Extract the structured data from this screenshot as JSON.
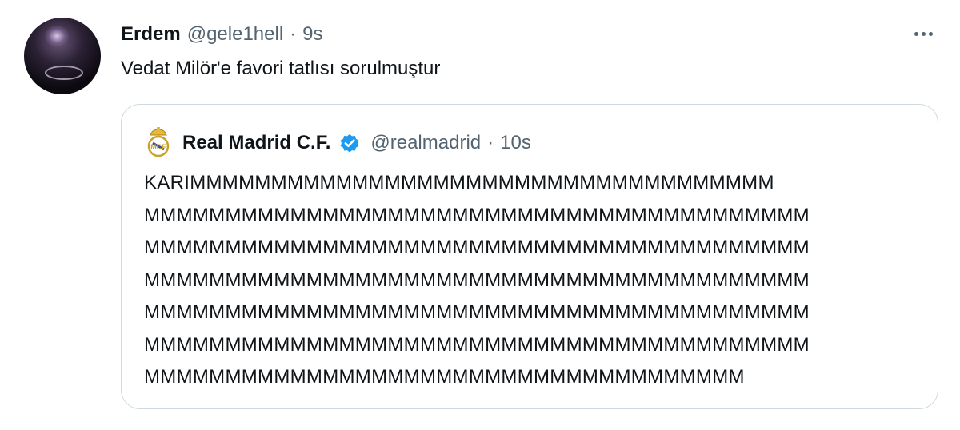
{
  "tweet": {
    "author_name": "Erdem",
    "author_handle": "@gele1hell",
    "separator": "·",
    "timestamp": "9s",
    "text": "Vedat Milör'e favori tatlısı sorulmuştur"
  },
  "quoted_tweet": {
    "author_name": "Real Madrid C.F.",
    "author_handle": "@realmadrid",
    "separator": "·",
    "timestamp": "10s",
    "verified": true,
    "lines": [
      "KARIMMMMMMMMMMMMMMMMMMMMMMMMMMMMMMMMMMMM",
      "MMMMMMMMMMMMMMMMMMMMMMMMMMMMMMMMMMMMMMMMM",
      "MMMMMMMMMMMMMMMMMMMMMMMMMMMMMMMMMMMMMMMMM",
      "MMMMMMMMMMMMMMMMMMMMMMMMMMMMMMMMMMMMMMMMM",
      "MMMMMMMMMMMMMMMMMMMMMMMMMMMMMMMMMMMMMMMMM",
      "MMMMMMMMMMMMMMMMMMMMMMMMMMMMMMMMMMMMMMMMM",
      "MMMMMMMMMMMMMMMMMMMMMMMMMMMMMMMMMMMMM"
    ]
  },
  "colors": {
    "text_primary": "#0f1419",
    "text_secondary": "#536471",
    "border": "#cfd9de",
    "verified_blue": "#1d9bf0"
  },
  "icons": {
    "more": "more-horizontal-icon",
    "verified": "verified-badge-icon",
    "crest": "real-madrid-crest-icon"
  }
}
